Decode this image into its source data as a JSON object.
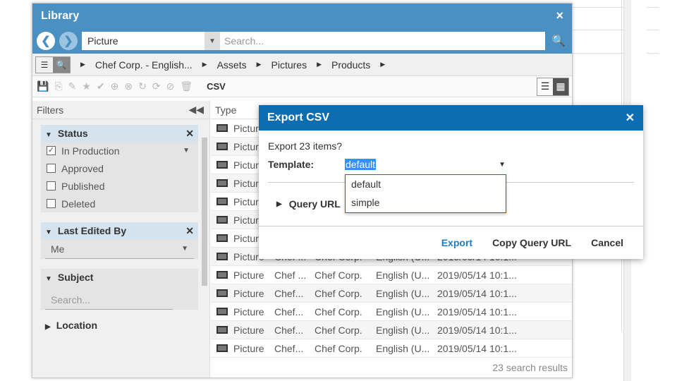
{
  "library": {
    "title": "Library",
    "close_icon": "×",
    "type_value": "Picture",
    "search_placeholder": "Search...",
    "breadcrumb": [
      "Chef Corp. - English...",
      "Assets",
      "Pictures",
      "Products"
    ],
    "toolbar": {
      "csv_label": "CSV"
    }
  },
  "filters": {
    "title": "Filters",
    "status": {
      "title": "Status",
      "options": [
        {
          "label": "In Production",
          "checked": true
        },
        {
          "label": "Approved",
          "checked": false
        },
        {
          "label": "Published",
          "checked": false
        },
        {
          "label": "Deleted",
          "checked": false
        }
      ]
    },
    "last_edited_by": {
      "title": "Last Edited By",
      "value": "Me"
    },
    "subject": {
      "title": "Subject",
      "placeholder": "Search..."
    },
    "location": {
      "title": "Location"
    }
  },
  "grid": {
    "headers": [
      "Type"
    ],
    "rows": [
      [
        "Picture",
        "",
        "",
        "",
        ""
      ],
      [
        "Picture",
        "",
        "",
        "",
        ""
      ],
      [
        "Picture",
        "",
        "",
        "",
        ""
      ],
      [
        "Picture",
        "",
        "",
        "",
        ""
      ],
      [
        "Picture",
        "",
        "",
        "",
        ""
      ],
      [
        "Picture",
        "",
        "",
        "",
        ""
      ],
      [
        "Picture",
        "",
        "",
        "",
        ""
      ],
      [
        "Picture",
        "Chef ...",
        "Chef Corp.",
        "English (U...",
        "2019/05/14 10:1..."
      ],
      [
        "Picture",
        "Chef ...",
        "Chef Corp.",
        "English (U...",
        "2019/05/14 10:1..."
      ],
      [
        "Picture",
        "Chef...",
        "Chef Corp.",
        "English (U...",
        "2019/05/14 10:1..."
      ],
      [
        "Picture",
        "Chef...",
        "Chef Corp.",
        "English (U...",
        "2019/05/14 10:1..."
      ],
      [
        "Picture",
        "Chef...",
        "Chef Corp.",
        "English (U...",
        "2019/05/14 10:1..."
      ],
      [
        "Picture",
        "Chef...",
        "Chef Corp.",
        "English (U...",
        "2019/05/14 10:1..."
      ]
    ],
    "results": "23 search results"
  },
  "modal": {
    "title": "Export CSV",
    "message": "Export 23 items?",
    "template_label": "Template:",
    "template_value": "default",
    "options": [
      "default",
      "simple"
    ],
    "query_url_label": "Query URL",
    "buttons": {
      "export": "Export",
      "copy": "Copy Query URL",
      "cancel": "Cancel"
    }
  }
}
